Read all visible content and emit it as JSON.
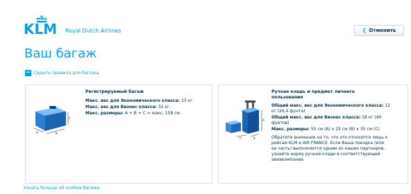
{
  "brand": {
    "logo_text": "KLM",
    "tagline": "Royal Dutch Airlines",
    "accent": "#00a1de",
    "dark": "#003145"
  },
  "header": {
    "cancel_label": "Отменить"
  },
  "page": {
    "title": "Ваш багаж",
    "toggle_label": "Скрыть правила для багажа"
  },
  "checked": {
    "title": "Регистрируемый багаж",
    "economy_label": "Макс. вес для Экономического класса:",
    "economy_value": " 23 кг.",
    "business_label": "Макс. вес для Бизнес класса:",
    "business_value": " 32 кг.",
    "size_label": "Макс. размеры:",
    "size_value": " A + B + C = макс. 158 см.",
    "dims": {
      "a": "A",
      "b": "B",
      "c": "C"
    }
  },
  "cabin": {
    "title_line1": "Ручная кладь и предмет личного",
    "title_line2": "пользования",
    "economy_label": "Общий макс. вес для Экономического класса:",
    "economy_value": " 12",
    "economy_line2": "кг (26,4 фунта)",
    "business_label": "Общий макс. вес для Бизнес класса:",
    "business_value": " 18 кг (40",
    "business_line2": "фунтов)",
    "size_label": "Макс. размеры:",
    "size_value": " 55 см (A) x 25 см (B) x 35 см (C)",
    "note_lines": [
      "Обратите внимание на то, что это относится лишь к",
      "рейсам KLM и AIR FRANCE. Если Ваша поездка (или",
      "ее часть) выполняется одним из наших партнеров,",
      "узнайте норму ручной клади в соответствующей",
      "авиакомпании."
    ],
    "dims": {
      "a": "A",
      "b": "B",
      "c": "C"
    }
  },
  "footer": {
    "special_link": "Узнать больше об особом багаже"
  }
}
